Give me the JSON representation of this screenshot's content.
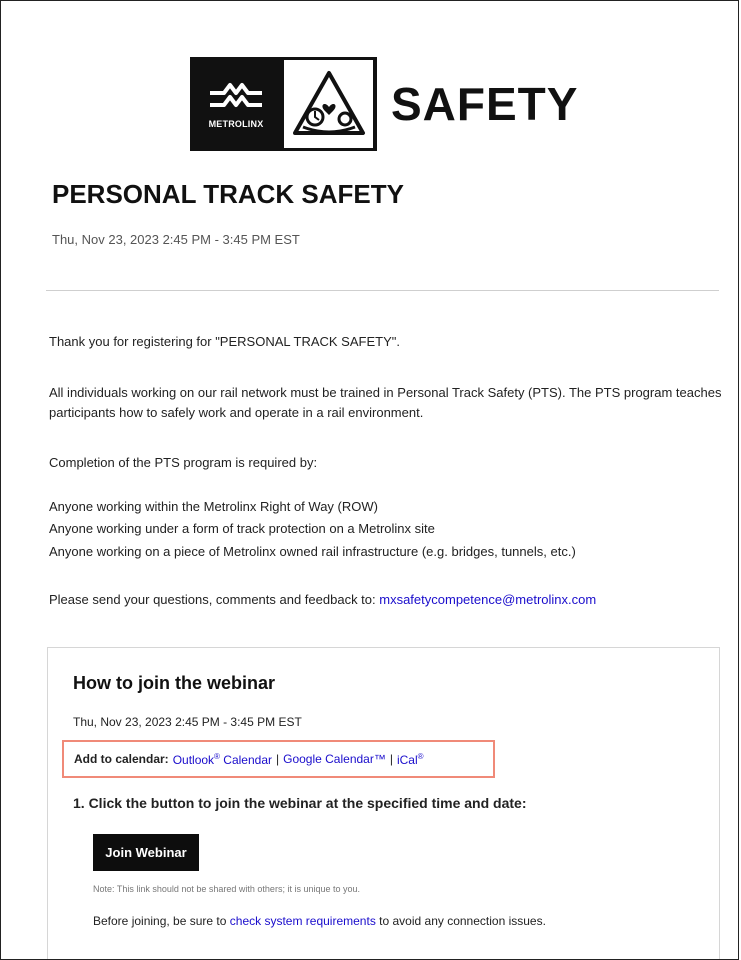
{
  "header": {
    "logo_wordmark": "METROLINX",
    "logo_text": "SAFETY"
  },
  "event": {
    "title": "PERSONAL TRACK SAFETY",
    "datetime": "Thu, Nov 23, 2023 2:45 PM - 3:45 PM EST"
  },
  "message": {
    "thanks": "Thank you for registering for \"PERSONAL TRACK SAFETY\".",
    "intro": "All individuals working on our rail network must be trained in Personal Track Safety (PTS). The PTS program teaches participants how to safely work and operate in a rail environment.",
    "required_by": "Completion of the PTS program is required by:",
    "list": [
      "Anyone working within the Metrolinx Right of Way (ROW)",
      "Anyone working under a form of track protection on a Metrolinx site",
      "Anyone working on a piece of Metrolinx owned rail infrastructure (e.g. bridges, tunnels, etc.)"
    ],
    "contact_prefix": "Please send your questions, comments and feedback to: ",
    "contact_email": "mxsafetycompetence@metrolinx.com"
  },
  "webinar": {
    "title": "How to join the webinar",
    "datetime": "Thu, Nov 23, 2023 2:45 PM - 3:45 PM EST",
    "calendar": {
      "label": "Add to calendar:",
      "outlook": "Outlook",
      "outlook_suffix": " Calendar",
      "reg_mark": "®",
      "separator": "|",
      "google": "Google Calendar™",
      "ical": "iCal"
    },
    "step1": "1. Click the button to join the webinar at the specified time and date:",
    "join_button": "Join Webinar",
    "note": "Note: This link should not be shared with others; it is unique to you.",
    "before_prefix": "Before joining, be sure to ",
    "system_req_link": "check system requirements",
    "before_suffix": " to avoid any connection issues."
  }
}
